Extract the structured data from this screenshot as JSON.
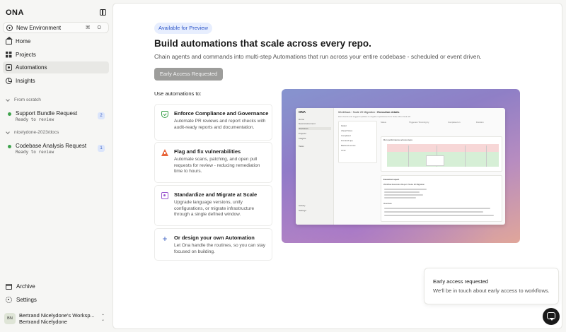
{
  "sidebar": {
    "logo": "ONA",
    "new_environment": {
      "label": "New Environment",
      "shortcut": "⌘ O"
    },
    "nav": [
      {
        "label": "Home",
        "icon": "home-icon"
      },
      {
        "label": "Projects",
        "icon": "grid-icon"
      },
      {
        "label": "Automations",
        "icon": "automations-icon",
        "active": true
      },
      {
        "label": "Insights",
        "icon": "insights-icon"
      }
    ],
    "groups": [
      {
        "heading": "From scratch",
        "items": [
          {
            "title": "Support Bundle Request",
            "status": "Ready to review",
            "badge": "2"
          }
        ]
      },
      {
        "heading": "nicelydone-2023/docs",
        "items": [
          {
            "title": "Codebase Analysis Request",
            "status": "Ready to review",
            "badge": "1"
          }
        ]
      }
    ],
    "bottom": {
      "archive": "Archive",
      "settings": "Settings"
    },
    "account": {
      "initials": "BN",
      "workspace": "Bertrand Nicelydone's Worksp...",
      "user": "Bertrand Nicelydone"
    }
  },
  "main": {
    "pill": "Available for Preview",
    "headline": "Build automations that scale across every repo.",
    "subhead": "Chain agents and commands into multi-step Automations that run across your entire codebase - scheduled or event driven.",
    "cta": "Early Access Requested",
    "use_label": "Use automations to:",
    "cards": [
      {
        "title": "Enforce Compliance and Governance",
        "desc": "Automate PR reviews and report checks with audit-ready reports and documentation.",
        "icon": "shield-icon"
      },
      {
        "title": "Flag and fix vulnerabilities",
        "desc": "Automate scans, patching, and open pull requests for review - reducing remediation time to hours.",
        "icon": "warning-icon"
      },
      {
        "title": "Standardize and Migrate at Scale",
        "desc": "Upgrade language versions, unify configurations, or migrate infrastructure through a single defined window.",
        "icon": "migrate-icon"
      },
      {
        "title": "Or design your own Automation",
        "desc": "Let Ona handle the routines, so you can stay focused on building.",
        "icon": "plus-icon"
      }
    ],
    "preview": {
      "logo": "ONA",
      "nav": [
        "Home",
        "New Environment",
        "Workflows",
        "Projects",
        "Insights",
        "Tasks",
        "Activity",
        "Settings"
      ],
      "crumb_1": "Workflows",
      "crumb_2": "Node 20 Migration",
      "crumb_3": "Execution details",
      "hint": "Run checks and suggest updates to migrate repositories from Node 18 to Node 20.",
      "list": [
        "Failed",
        "Ahead Notes",
        "Completed",
        "Frontend app",
        "Backend service",
        "UI kit"
      ],
      "stats": [
        "Status",
        "Triggered / Running by",
        "Completed on",
        "Duration"
      ],
      "chart_title": "Run performance across steps",
      "report_title": "Execution report",
      "report_heading": "Workflow Execution Report: Node 20 Migration",
      "overview": "Overview"
    }
  },
  "toast": {
    "title": "Early access requested",
    "body": "We'll be in touch about early access to workflows."
  },
  "colors": {
    "accent_blue": "#2f57c9",
    "success_green": "#3fa34d",
    "warning_orange": "#e8663b",
    "migrate_purple": "#9b59d0"
  }
}
